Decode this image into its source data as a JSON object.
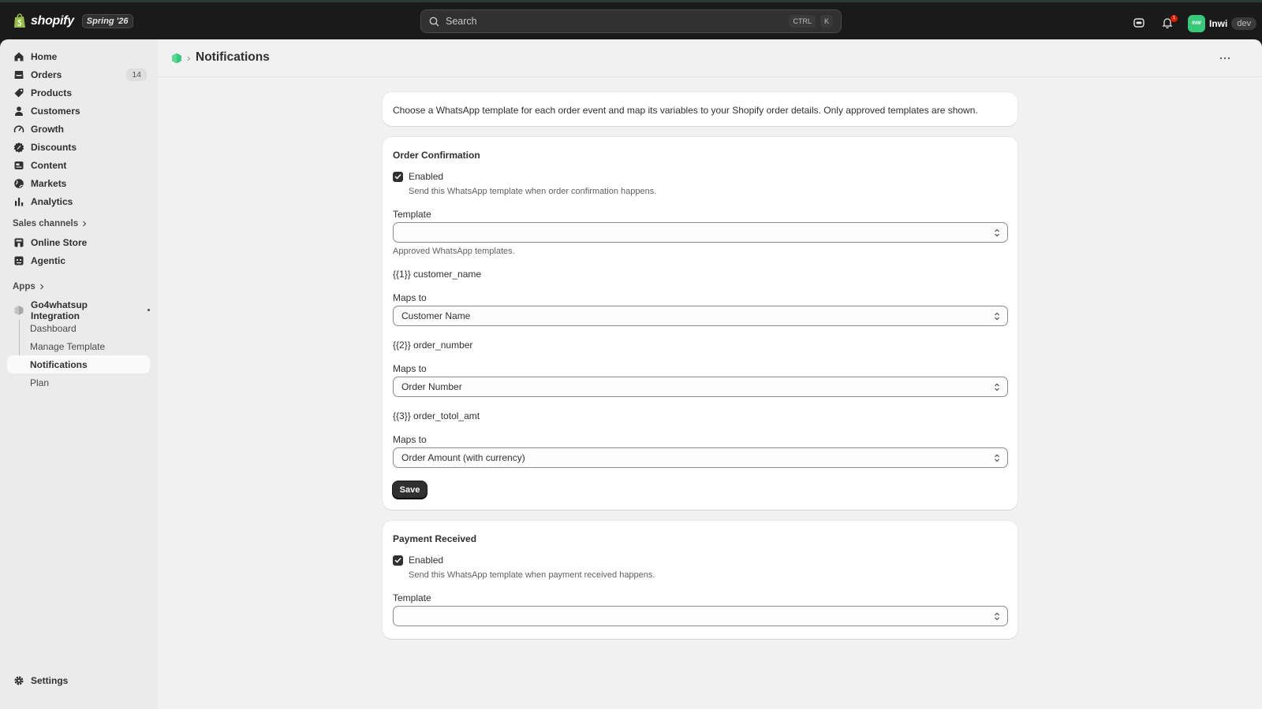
{
  "topbar": {
    "brand": "shopify",
    "edition": "Spring '26",
    "search_placeholder": "Search",
    "shortcut_keys": [
      "CTRL",
      "K"
    ],
    "notification_count": "1",
    "user_initials": "INW",
    "user_name": "Inwi",
    "user_tag": "dev"
  },
  "sidebar": {
    "nav": [
      {
        "label": "Home",
        "icon": "home-icon"
      },
      {
        "label": "Orders",
        "icon": "inbox-icon",
        "badge": "14"
      },
      {
        "label": "Products",
        "icon": "tag-icon"
      },
      {
        "label": "Customers",
        "icon": "person-icon"
      },
      {
        "label": "Growth",
        "icon": "gauge-icon"
      },
      {
        "label": "Discounts",
        "icon": "discount-icon"
      },
      {
        "label": "Content",
        "icon": "content-icon"
      },
      {
        "label": "Markets",
        "icon": "globe-icon"
      },
      {
        "label": "Analytics",
        "icon": "bar-chart-icon"
      }
    ],
    "sales_channels_label": "Sales channels",
    "channels": [
      {
        "label": "Online Store",
        "icon": "store-icon"
      },
      {
        "label": "Agentic",
        "icon": "agentic-icon"
      }
    ],
    "apps_label": "Apps",
    "app": {
      "label": "Go4whatsup Integration",
      "sub_items": [
        "Dashboard",
        "Manage Template",
        "Notifications",
        "Plan"
      ],
      "active": "Notifications"
    },
    "settings_label": "Settings"
  },
  "page": {
    "title": "Notifications",
    "breadcrumb_separator": "›",
    "intro": "Choose a WhatsApp template for each order event and map its variables to your Shopify order details. Only approved templates are shown."
  },
  "sections": [
    {
      "title": "Order Confirmation",
      "enabled_label": "Enabled",
      "enabled": true,
      "help": "Send this WhatsApp template when order confirmation happens.",
      "template_label": "Template",
      "template_value": "",
      "template_help": "Approved WhatsApp templates.",
      "variables": [
        {
          "name": "{{1}} customer_name",
          "maps_label": "Maps to",
          "value": "Customer Name"
        },
        {
          "name": "{{2}} order_number",
          "maps_label": "Maps to",
          "value": "Order Number"
        },
        {
          "name": "{{3}} order_totol_amt",
          "maps_label": "Maps to",
          "value": "Order Amount (with currency)"
        }
      ],
      "save_label": "Save"
    },
    {
      "title": "Payment Received",
      "enabled_label": "Enabled",
      "enabled": true,
      "help": "Send this WhatsApp template when payment received happens.",
      "template_label": "Template",
      "template_value": ""
    }
  ],
  "colors": {
    "topbar_bg": "#1a1a1a",
    "sidebar_bg": "#ebebeb",
    "main_bg": "#f1f1f1",
    "primary_button": "#303030",
    "app_accent": "#36c97a",
    "badge_alert": "#e51c00"
  }
}
